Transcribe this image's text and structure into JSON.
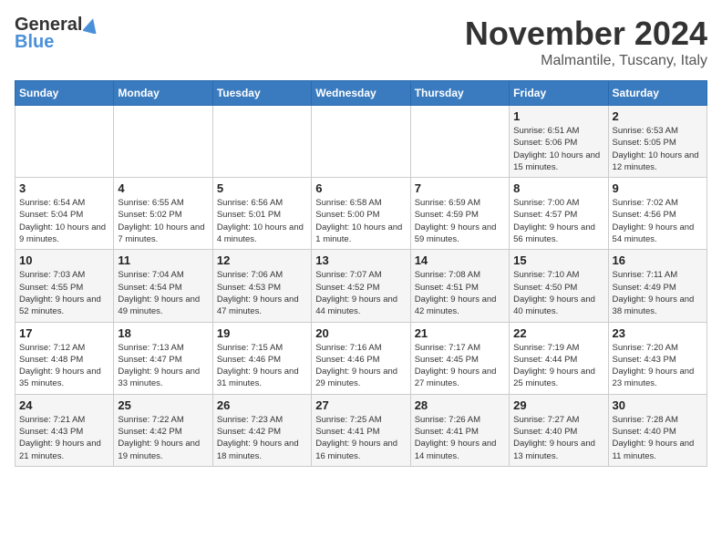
{
  "logo": {
    "general": "General",
    "blue": "Blue"
  },
  "title": "November 2024",
  "location": "Malmantile, Tuscany, Italy",
  "weekdays": [
    "Sunday",
    "Monday",
    "Tuesday",
    "Wednesday",
    "Thursday",
    "Friday",
    "Saturday"
  ],
  "weeks": [
    [
      {
        "day": "",
        "info": ""
      },
      {
        "day": "",
        "info": ""
      },
      {
        "day": "",
        "info": ""
      },
      {
        "day": "",
        "info": ""
      },
      {
        "day": "",
        "info": ""
      },
      {
        "day": "1",
        "info": "Sunrise: 6:51 AM\nSunset: 5:06 PM\nDaylight: 10 hours and 15 minutes."
      },
      {
        "day": "2",
        "info": "Sunrise: 6:53 AM\nSunset: 5:05 PM\nDaylight: 10 hours and 12 minutes."
      }
    ],
    [
      {
        "day": "3",
        "info": "Sunrise: 6:54 AM\nSunset: 5:04 PM\nDaylight: 10 hours and 9 minutes."
      },
      {
        "day": "4",
        "info": "Sunrise: 6:55 AM\nSunset: 5:02 PM\nDaylight: 10 hours and 7 minutes."
      },
      {
        "day": "5",
        "info": "Sunrise: 6:56 AM\nSunset: 5:01 PM\nDaylight: 10 hours and 4 minutes."
      },
      {
        "day": "6",
        "info": "Sunrise: 6:58 AM\nSunset: 5:00 PM\nDaylight: 10 hours and 1 minute."
      },
      {
        "day": "7",
        "info": "Sunrise: 6:59 AM\nSunset: 4:59 PM\nDaylight: 9 hours and 59 minutes."
      },
      {
        "day": "8",
        "info": "Sunrise: 7:00 AM\nSunset: 4:57 PM\nDaylight: 9 hours and 56 minutes."
      },
      {
        "day": "9",
        "info": "Sunrise: 7:02 AM\nSunset: 4:56 PM\nDaylight: 9 hours and 54 minutes."
      }
    ],
    [
      {
        "day": "10",
        "info": "Sunrise: 7:03 AM\nSunset: 4:55 PM\nDaylight: 9 hours and 52 minutes."
      },
      {
        "day": "11",
        "info": "Sunrise: 7:04 AM\nSunset: 4:54 PM\nDaylight: 9 hours and 49 minutes."
      },
      {
        "day": "12",
        "info": "Sunrise: 7:06 AM\nSunset: 4:53 PM\nDaylight: 9 hours and 47 minutes."
      },
      {
        "day": "13",
        "info": "Sunrise: 7:07 AM\nSunset: 4:52 PM\nDaylight: 9 hours and 44 minutes."
      },
      {
        "day": "14",
        "info": "Sunrise: 7:08 AM\nSunset: 4:51 PM\nDaylight: 9 hours and 42 minutes."
      },
      {
        "day": "15",
        "info": "Sunrise: 7:10 AM\nSunset: 4:50 PM\nDaylight: 9 hours and 40 minutes."
      },
      {
        "day": "16",
        "info": "Sunrise: 7:11 AM\nSunset: 4:49 PM\nDaylight: 9 hours and 38 minutes."
      }
    ],
    [
      {
        "day": "17",
        "info": "Sunrise: 7:12 AM\nSunset: 4:48 PM\nDaylight: 9 hours and 35 minutes."
      },
      {
        "day": "18",
        "info": "Sunrise: 7:13 AM\nSunset: 4:47 PM\nDaylight: 9 hours and 33 minutes."
      },
      {
        "day": "19",
        "info": "Sunrise: 7:15 AM\nSunset: 4:46 PM\nDaylight: 9 hours and 31 minutes."
      },
      {
        "day": "20",
        "info": "Sunrise: 7:16 AM\nSunset: 4:46 PM\nDaylight: 9 hours and 29 minutes."
      },
      {
        "day": "21",
        "info": "Sunrise: 7:17 AM\nSunset: 4:45 PM\nDaylight: 9 hours and 27 minutes."
      },
      {
        "day": "22",
        "info": "Sunrise: 7:19 AM\nSunset: 4:44 PM\nDaylight: 9 hours and 25 minutes."
      },
      {
        "day": "23",
        "info": "Sunrise: 7:20 AM\nSunset: 4:43 PM\nDaylight: 9 hours and 23 minutes."
      }
    ],
    [
      {
        "day": "24",
        "info": "Sunrise: 7:21 AM\nSunset: 4:43 PM\nDaylight: 9 hours and 21 minutes."
      },
      {
        "day": "25",
        "info": "Sunrise: 7:22 AM\nSunset: 4:42 PM\nDaylight: 9 hours and 19 minutes."
      },
      {
        "day": "26",
        "info": "Sunrise: 7:23 AM\nSunset: 4:42 PM\nDaylight: 9 hours and 18 minutes."
      },
      {
        "day": "27",
        "info": "Sunrise: 7:25 AM\nSunset: 4:41 PM\nDaylight: 9 hours and 16 minutes."
      },
      {
        "day": "28",
        "info": "Sunrise: 7:26 AM\nSunset: 4:41 PM\nDaylight: 9 hours and 14 minutes."
      },
      {
        "day": "29",
        "info": "Sunrise: 7:27 AM\nSunset: 4:40 PM\nDaylight: 9 hours and 13 minutes."
      },
      {
        "day": "30",
        "info": "Sunrise: 7:28 AM\nSunset: 4:40 PM\nDaylight: 9 hours and 11 minutes."
      }
    ]
  ]
}
